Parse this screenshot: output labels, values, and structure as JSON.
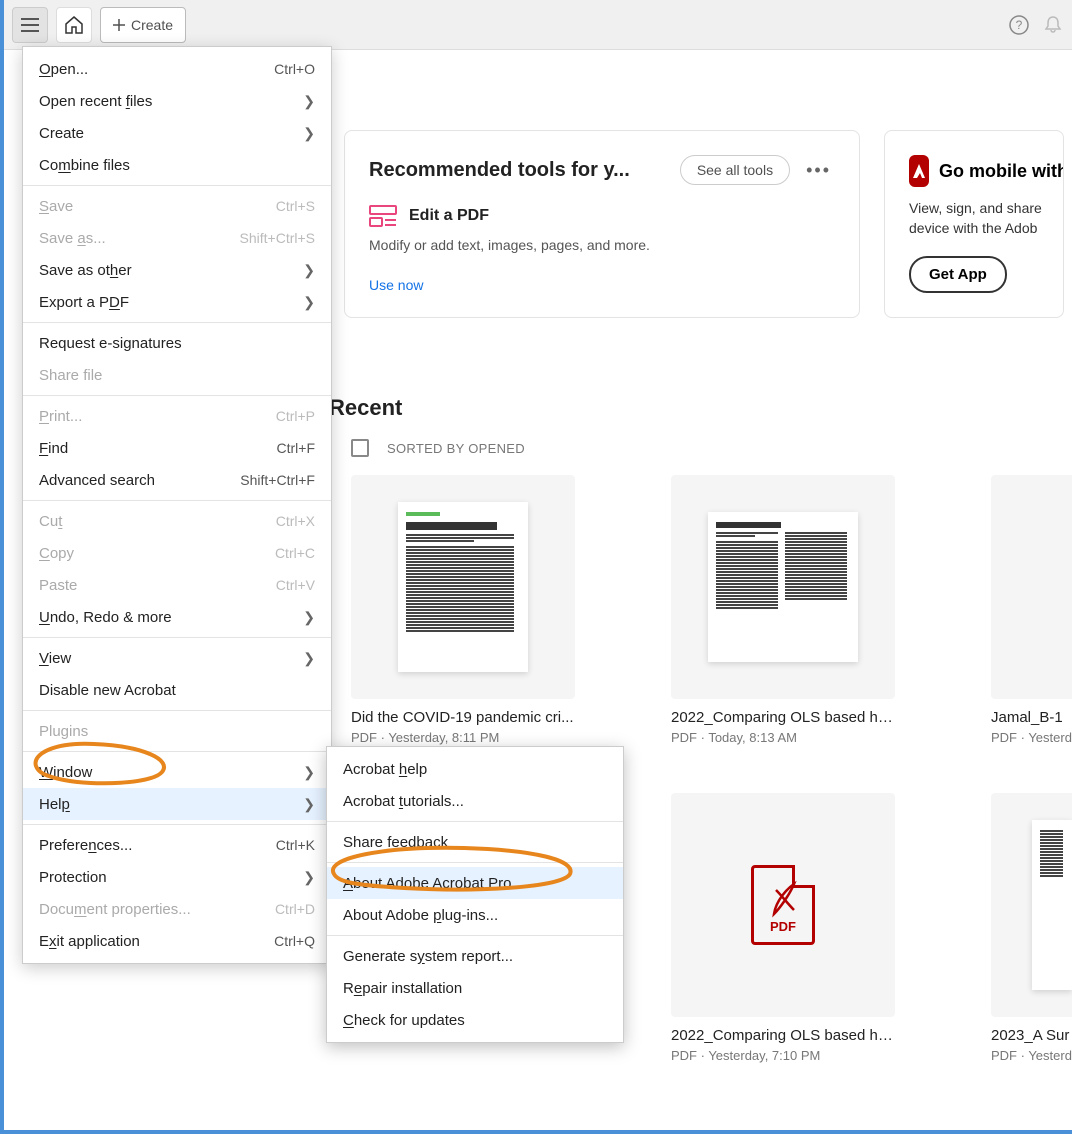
{
  "toolbar": {
    "create_label": "Create"
  },
  "tools_card": {
    "title": "Recommended tools for y...",
    "see_all": "See all tools",
    "edit_label": "Edit a PDF",
    "edit_desc": "Modify or add text, images, pages, and more.",
    "use_now": "Use now"
  },
  "mobile_card": {
    "title": "Go mobile with",
    "desc_l1": "View, sign, and share",
    "desc_l2": "device with the Adob",
    "get_app": "Get App"
  },
  "recent": {
    "title": "Recent",
    "sort_label": "SORTED BY OPENED",
    "files": [
      {
        "name": "Did the COVID-19 pandemic cri...",
        "meta": "PDF  ·  Yesterday, 8:11 PM"
      },
      {
        "name": "2022_Comparing OLS based he...",
        "meta": "PDF  ·  Today, 8:13 AM"
      },
      {
        "name": "Jamal_B-1",
        "meta": "PDF  ·  Yesterda"
      },
      {
        "name": "",
        "meta": ""
      },
      {
        "name": "2022_Comparing OLS based he...",
        "meta": "PDF  ·  Yesterday, 7:10 PM"
      },
      {
        "name": "2023_A Sur",
        "meta": "PDF  ·  Yesterda"
      }
    ]
  },
  "main_menu": [
    {
      "label_pre": "",
      "u": "O",
      "label_post": "pen...",
      "shortcut": "Ctrl+O",
      "chevron": false,
      "disabled": false,
      "sep_after": false,
      "highlighted": false
    },
    {
      "label_pre": "Open recent ",
      "u": "f",
      "label_post": "iles",
      "shortcut": "",
      "chevron": true,
      "disabled": false,
      "sep_after": false,
      "highlighted": false
    },
    {
      "label_pre": "Create",
      "u": "",
      "label_post": "",
      "shortcut": "",
      "chevron": true,
      "disabled": false,
      "sep_after": false,
      "highlighted": false
    },
    {
      "label_pre": "Co",
      "u": "m",
      "label_post": "bine files",
      "shortcut": "",
      "chevron": false,
      "disabled": false,
      "sep_after": true,
      "highlighted": false
    },
    {
      "label_pre": "",
      "u": "S",
      "label_post": "ave",
      "shortcut": "Ctrl+S",
      "chevron": false,
      "disabled": true,
      "sep_after": false,
      "highlighted": false
    },
    {
      "label_pre": "Save ",
      "u": "a",
      "label_post": "s...",
      "shortcut": "Shift+Ctrl+S",
      "chevron": false,
      "disabled": true,
      "sep_after": false,
      "highlighted": false
    },
    {
      "label_pre": "Save as ot",
      "u": "h",
      "label_post": "er",
      "shortcut": "",
      "chevron": true,
      "disabled": false,
      "sep_after": false,
      "highlighted": false
    },
    {
      "label_pre": "Export a P",
      "u": "D",
      "label_post": "F",
      "shortcut": "",
      "chevron": true,
      "disabled": false,
      "sep_after": true,
      "highlighted": false
    },
    {
      "label_pre": "Request e-signatures",
      "u": "",
      "label_post": "",
      "shortcut": "",
      "chevron": false,
      "disabled": false,
      "sep_after": false,
      "highlighted": false
    },
    {
      "label_pre": "Share file",
      "u": "",
      "label_post": "",
      "shortcut": "",
      "chevron": false,
      "disabled": true,
      "sep_after": true,
      "highlighted": false
    },
    {
      "label_pre": "",
      "u": "P",
      "label_post": "rint...",
      "shortcut": "Ctrl+P",
      "chevron": false,
      "disabled": true,
      "sep_after": false,
      "highlighted": false
    },
    {
      "label_pre": "",
      "u": "F",
      "label_post": "ind",
      "shortcut": "Ctrl+F",
      "chevron": false,
      "disabled": false,
      "sep_after": false,
      "highlighted": false
    },
    {
      "label_pre": "Advanced search",
      "u": "",
      "label_post": "",
      "shortcut": "Shift+Ctrl+F",
      "chevron": false,
      "disabled": false,
      "sep_after": true,
      "highlighted": false
    },
    {
      "label_pre": "Cu",
      "u": "t",
      "label_post": "",
      "shortcut": "Ctrl+X",
      "chevron": false,
      "disabled": true,
      "sep_after": false,
      "highlighted": false
    },
    {
      "label_pre": "",
      "u": "C",
      "label_post": "opy",
      "shortcut": "Ctrl+C",
      "chevron": false,
      "disabled": true,
      "sep_after": false,
      "highlighted": false
    },
    {
      "label_pre": "Paste",
      "u": "",
      "label_post": "",
      "shortcut": "Ctrl+V",
      "chevron": false,
      "disabled": true,
      "sep_after": false,
      "highlighted": false
    },
    {
      "label_pre": "",
      "u": "U",
      "label_post": "ndo, Redo & more",
      "shortcut": "",
      "chevron": true,
      "disabled": false,
      "sep_after": true,
      "highlighted": false
    },
    {
      "label_pre": "",
      "u": "V",
      "label_post": "iew",
      "shortcut": "",
      "chevron": true,
      "disabled": false,
      "sep_after": false,
      "highlighted": false
    },
    {
      "label_pre": "Disable new Acrobat",
      "u": "",
      "label_post": "",
      "shortcut": "",
      "chevron": false,
      "disabled": false,
      "sep_after": true,
      "highlighted": false
    },
    {
      "label_pre": "Plugins",
      "u": "",
      "label_post": "",
      "shortcut": "",
      "chevron": false,
      "disabled": true,
      "sep_after": true,
      "highlighted": false
    },
    {
      "label_pre": "",
      "u": "W",
      "label_post": "indow",
      "shortcut": "",
      "chevron": true,
      "disabled": false,
      "sep_after": false,
      "highlighted": false
    },
    {
      "label_pre": "Hel",
      "u": "p",
      "label_post": "",
      "shortcut": "",
      "chevron": true,
      "disabled": false,
      "sep_after": true,
      "highlighted": true
    },
    {
      "label_pre": "Prefere",
      "u": "n",
      "label_post": "ces...",
      "shortcut": "Ctrl+K",
      "chevron": false,
      "disabled": false,
      "sep_after": false,
      "highlighted": false
    },
    {
      "label_pre": "Protection",
      "u": "",
      "label_post": "",
      "shortcut": "",
      "chevron": true,
      "disabled": false,
      "sep_after": false,
      "highlighted": false
    },
    {
      "label_pre": "Docu",
      "u": "m",
      "label_post": "ent properties...",
      "shortcut": "Ctrl+D",
      "chevron": false,
      "disabled": true,
      "sep_after": false,
      "highlighted": false
    },
    {
      "label_pre": "E",
      "u": "x",
      "label_post": "it application",
      "shortcut": "Ctrl+Q",
      "chevron": false,
      "disabled": false,
      "sep_after": false,
      "highlighted": false
    }
  ],
  "submenu": [
    {
      "label_pre": "Acrobat ",
      "u": "h",
      "label_post": "elp",
      "sep_after": false,
      "highlighted": false
    },
    {
      "label_pre": "Acrobat ",
      "u": "t",
      "label_post": "utorials...",
      "sep_after": true,
      "highlighted": false
    },
    {
      "label_pre": "Share feedback",
      "u": "",
      "label_post": "",
      "sep_after": true,
      "highlighted": false
    },
    {
      "label_pre": "",
      "u": "A",
      "label_post": "bout Adobe Acrobat Pro...",
      "sep_after": false,
      "highlighted": true
    },
    {
      "label_pre": "About Adobe ",
      "u": "p",
      "label_post": "lug-ins...",
      "sep_after": true,
      "highlighted": false
    },
    {
      "label_pre": "Generate s",
      "u": "y",
      "label_post": "stem report...",
      "sep_after": false,
      "highlighted": false
    },
    {
      "label_pre": "R",
      "u": "e",
      "label_post": "pair installation",
      "sep_after": false,
      "highlighted": false
    },
    {
      "label_pre": "",
      "u": "C",
      "label_post": "heck for updates",
      "sep_after": false,
      "highlighted": false
    }
  ]
}
